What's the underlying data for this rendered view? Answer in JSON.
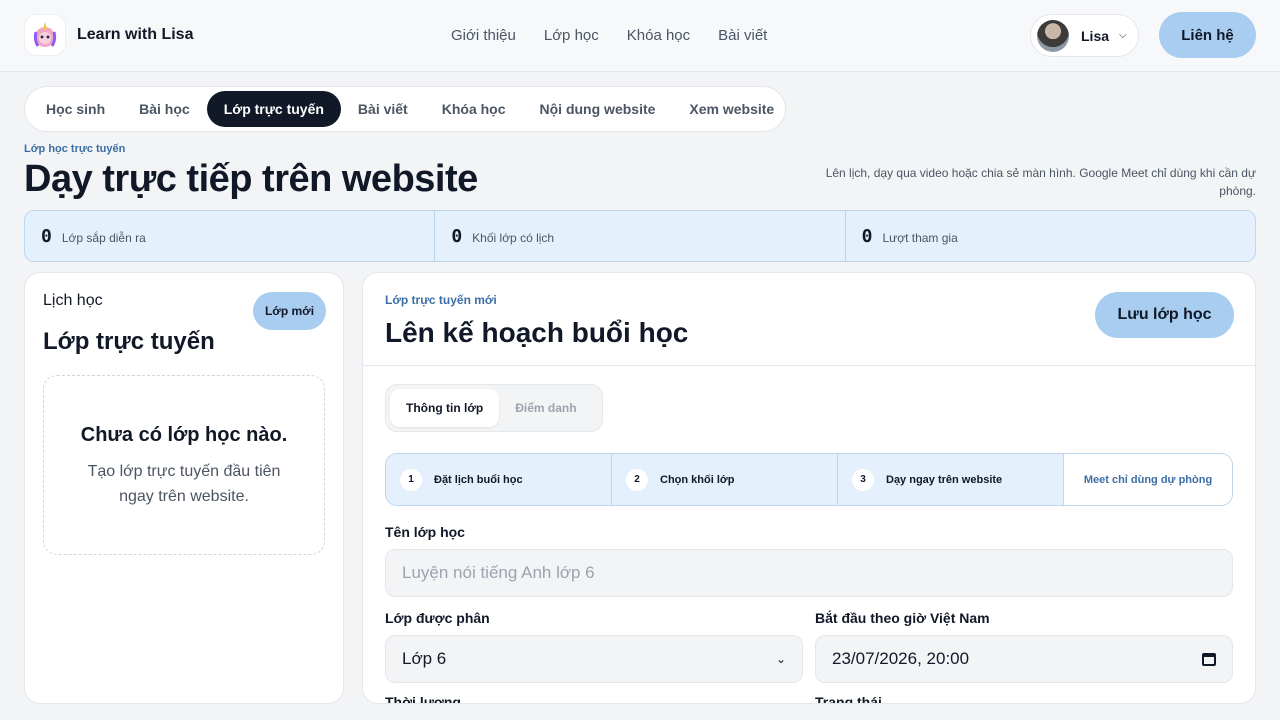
{
  "header": {
    "brand": "Learn with Lisa",
    "nav": [
      "Giới thiệu",
      "Lớp học",
      "Khóa học",
      "Bài viết"
    ],
    "user_name": "Lisa",
    "contact_label": "Liên hệ"
  },
  "tabs": [
    "Học sinh",
    "Bài học",
    "Lớp trực tuyến",
    "Bài viết",
    "Khóa học",
    "Nội dung website",
    "Xem website"
  ],
  "active_tab": "Lớp trực tuyến",
  "page": {
    "eyebrow": "Lớp học trực tuyến",
    "title": "Dạy trực tiếp trên website",
    "description": "Lên lịch, dạy qua video hoặc chia sẻ màn hình. Google Meet chỉ dùng khi cần dự phòng."
  },
  "stats": [
    {
      "value": "0",
      "label": "Lớp sắp diễn ra"
    },
    {
      "value": "0",
      "label": "Khối lớp có lịch"
    },
    {
      "value": "0",
      "label": "Lượt tham gia"
    }
  ],
  "schedule": {
    "label": "Lịch học",
    "title": "Lớp trực tuyến",
    "new_button": "Lớp mới",
    "empty_title": "Chưa có lớp học nào.",
    "empty_desc": "Tạo lớp trực tuyến đầu tiên ngay trên website."
  },
  "planner": {
    "eyebrow": "Lớp trực tuyến mới",
    "title": "Lên kế hoạch buổi học",
    "save_button": "Lưu lớp học",
    "subtabs": [
      "Thông tin lớp",
      "Điểm danh"
    ],
    "steps": [
      {
        "num": "1",
        "label": "Đặt lịch buổi học"
      },
      {
        "num": "2",
        "label": "Chọn khối lớp"
      },
      {
        "num": "3",
        "label": "Dạy ngay trên website"
      }
    ],
    "steps_note": "Meet chỉ dùng dự phòng",
    "fields": {
      "name_label": "Tên lớp học",
      "name_placeholder": "Luyện nói tiếng Anh lớp 6",
      "grade_label": "Lớp được phân",
      "grade_value": "Lớp 6",
      "start_label": "Bắt đầu theo giờ Việt Nam",
      "start_value": "23/07/2026, 20:00",
      "duration_label": "Thời lượng",
      "status_label": "Trạng thái"
    }
  }
}
